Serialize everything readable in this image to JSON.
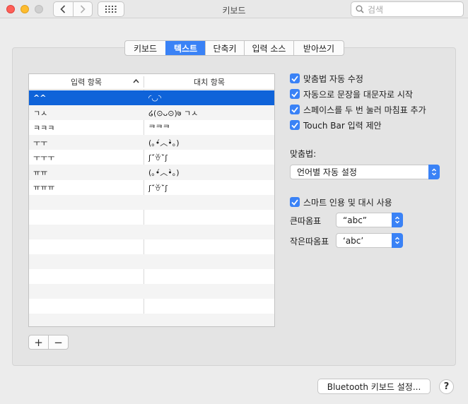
{
  "window": {
    "title": "키보드"
  },
  "search": {
    "placeholder": "검색"
  },
  "tabs": [
    {
      "label": "키보드",
      "width": 57
    },
    {
      "label": "텍스트",
      "width": 56,
      "active": true
    },
    {
      "label": "단축키",
      "width": 55
    },
    {
      "label": "입력 소스",
      "width": 70
    },
    {
      "label": "받아쓰기",
      "width": 71
    }
  ],
  "table": {
    "col_input": "입력 항목",
    "col_replace": "대치 항목",
    "rows": [
      {
        "input": "^^",
        "replace": "◜◡◝"
      },
      {
        "input": "ㄱㅅ",
        "replace": "໒(⊙ᴗ⊙)७ ㄱㅅ"
      },
      {
        "input": "ㅋㅋㅋ",
        "replace": "ᄏᄏᄏ"
      },
      {
        "input": "ㅜㅜ",
        "replace": "(｡•́︿•̀｡)"
      },
      {
        "input": "ㅜㅜㅜ",
        "replace": "ʃ˘́ꈊ˘̀ʃ"
      },
      {
        "input": "ㅠㅠ",
        "replace": "(｡•́︿•̀｡)"
      },
      {
        "input": "ㅠㅠㅠ",
        "replace": "ʃ˘́ꈊ˘̀ʃ"
      }
    ],
    "empty_rows": 9
  },
  "buttons": {
    "add": "+",
    "remove": "−",
    "bluetooth": "Bluetooth 키보드 설정...",
    "help": "?"
  },
  "options": {
    "autocorrect": "맞춤법 자동 수정",
    "capitalize": "자동으로 문장을 대문자로 시작",
    "period": "스페이스를 두 번 눌러 마침표 추가",
    "touchbar": "Touch Bar 입력 제안"
  },
  "spelling": {
    "label": "맞춤법:",
    "value": "언어별 자동 설정"
  },
  "smart_quotes": {
    "label": "스마트 인용 및 대시 사용",
    "double_label": "큰따옴표",
    "double_value": "“abc”",
    "single_label": "작은따옴표",
    "single_value": "‘abc’"
  },
  "colors": {
    "accent": "#3a82f6",
    "selection": "#0f63d9"
  }
}
